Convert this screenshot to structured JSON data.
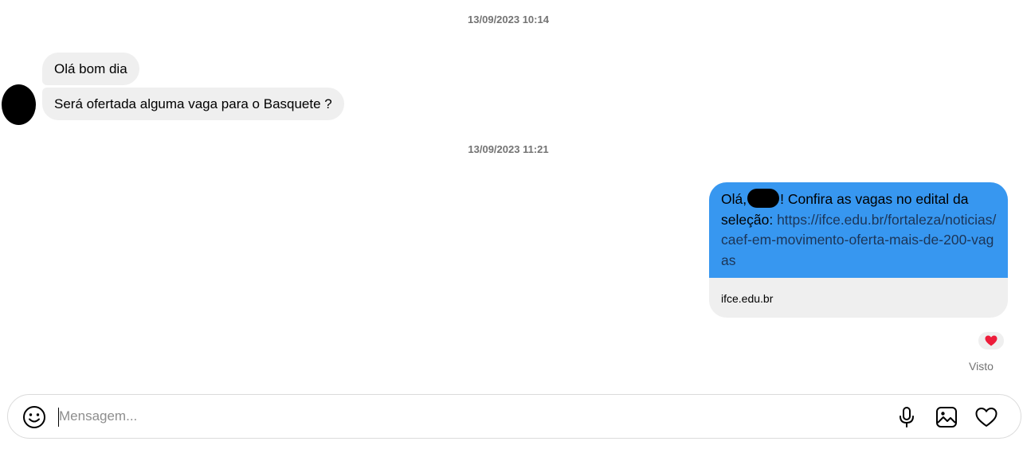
{
  "conversation": {
    "timestamps": [
      "13/09/2023 10:14",
      "13/09/2023 11:21"
    ],
    "incoming": [
      {
        "text": "Olá bom dia"
      },
      {
        "text": "Será ofertada alguma vaga para o Basquete ?"
      }
    ],
    "outgoing": {
      "greeting": "Olá,",
      "text_after_name": "! Confira as vagas no edital da seleção:",
      "link": "https://ifce.edu.br/fortaleza/noticias/caef-em-movimento-oferta-mais-de-200-vagas",
      "preview_domain": "ifce.edu.br",
      "reaction_icon": "red-heart-emoji",
      "status": "Visto"
    }
  },
  "composer": {
    "placeholder": "Mensagem...",
    "value": "",
    "icons": [
      "emoji-icon",
      "microphone-icon",
      "image-icon",
      "heart-icon"
    ]
  },
  "colors": {
    "outgoing_bubble": "#3797f0",
    "incoming_bubble": "#efefef",
    "link_text": "#1c3557",
    "reaction_heart": "#ed1c3a"
  }
}
